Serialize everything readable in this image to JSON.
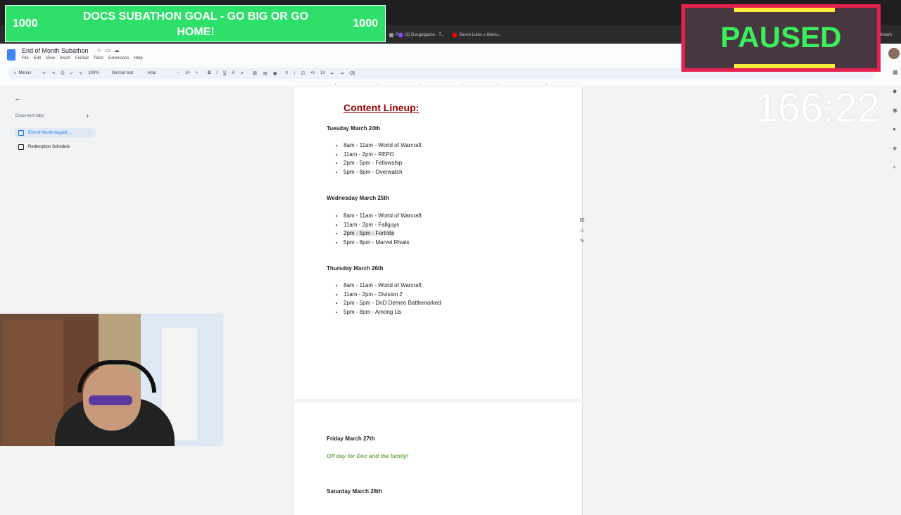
{
  "browser": {
    "bookmarks": [
      {
        "label": "Pal",
        "color": "#999999"
      },
      {
        "label": "(3) Docgotgame - T...",
        "color": "#9146ff"
      },
      {
        "label": "Seven Lions x Illeniu...",
        "color": "#ff0000"
      },
      {
        "label": "Bookmark",
        "color": "#888888"
      }
    ]
  },
  "docs": {
    "title": "End of Month Subathon",
    "menu": [
      "File",
      "Edit",
      "View",
      "Insert",
      "Format",
      "Tools",
      "Extensions",
      "Help"
    ],
    "toolbar": {
      "menus": "Menus",
      "zoom": "100%",
      "style": "Normal text",
      "font": "Arial",
      "size": "14"
    },
    "left_panel": {
      "heading": "Document tabs",
      "tabs": [
        {
          "label": "End of Month August ...",
          "active": true
        },
        {
          "label": "Redemption Schedule",
          "active": false
        }
      ]
    }
  },
  "document": {
    "title": "Content Lineup:",
    "days": [
      {
        "day": "Tuesday March 24th",
        "items": [
          "8am - 11am - World of Warcraft",
          "11am - 2pm - REPO",
          "2pm - 5pm - Fellowship",
          "5pm - 8pm - Overwatch"
        ]
      },
      {
        "day": "Wednesday March 25th",
        "items": [
          "8am - 11am - World of Warcraft",
          "11am - 2pm - Fallguys",
          "2pm - 5pm - Fortnite",
          "5pm - 8pm - Marvel Rivals"
        ]
      },
      {
        "day": "Thursday March 26th",
        "items": [
          "8am - 11am - World of Warcraft",
          "11am - 2pm - Division 2",
          "2pm - 5pm - DnD Demeo Battlemarked",
          "5pm - 8pm - Among Us"
        ]
      },
      {
        "day": "Friday March 27th",
        "items": []
      },
      {
        "day": "Saturday March 28th",
        "items": []
      }
    ],
    "friday_note": "Off day for Doc and the family!"
  },
  "overlay": {
    "goal_left": "1000",
    "goal_right": "1000",
    "goal_text": "DOCS SUBATHON GOAL - GO BIG OR GO HOME!",
    "paused": "PAUSED",
    "timer": "166:22",
    "colors": {
      "goal": "#2ee06a",
      "paused_border": "#e6204f",
      "paused_text": "#39f05a",
      "accent_bar": "#ffeb3b"
    }
  }
}
